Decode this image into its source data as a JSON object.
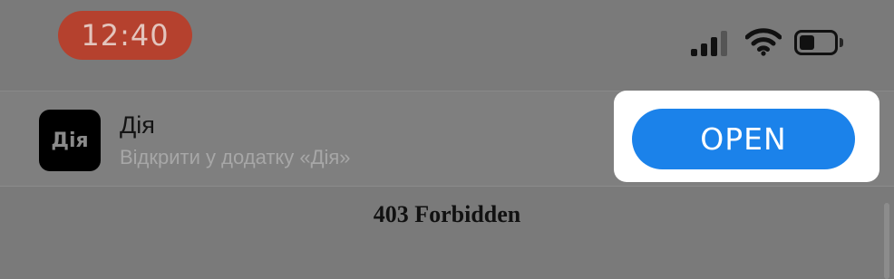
{
  "status_bar": {
    "time": "12:40",
    "time_pill_color": "#b5412e",
    "signal_icon": "cellular-signal-icon",
    "wifi_icon": "wifi-icon",
    "battery_icon": "battery-icon",
    "battery_level": 0.45
  },
  "app_banner": {
    "icon_text": "Дія",
    "app_name": "Дія",
    "subtitle": "Відкрити у додатку «Дія»",
    "open_label": "OPEN",
    "open_color": "#1b82ea"
  },
  "page": {
    "heading": "403 Forbidden"
  }
}
